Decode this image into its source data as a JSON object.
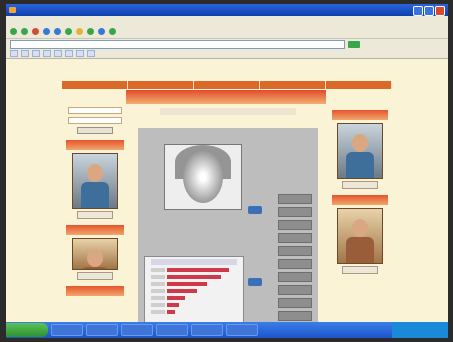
{
  "window": {
    "title": "",
    "buttons": [
      "minimize",
      "maximize",
      "close"
    ]
  },
  "menu": [],
  "toolbar": {
    "buttons": []
  },
  "address": {
    "value": ""
  },
  "links": [],
  "site": {
    "nav": [
      "",
      "",
      "",
      "",
      ""
    ],
    "left": {
      "header_1": "",
      "header_2": "",
      "header_3": "",
      "photo_caption_1": "",
      "photo_caption_2": ""
    },
    "right": {
      "link_1": "",
      "link_2": "",
      "photo_caption_1": "",
      "photo_caption_2": ""
    },
    "center": {
      "title": "",
      "subtitle": "",
      "result_title": ""
    }
  },
  "taskbar": {
    "start_label": "",
    "clock": ""
  },
  "colors": {
    "accent": "#d96a2a",
    "window_title": "#1f5bd1",
    "taskbar": "#2a63d5"
  }
}
